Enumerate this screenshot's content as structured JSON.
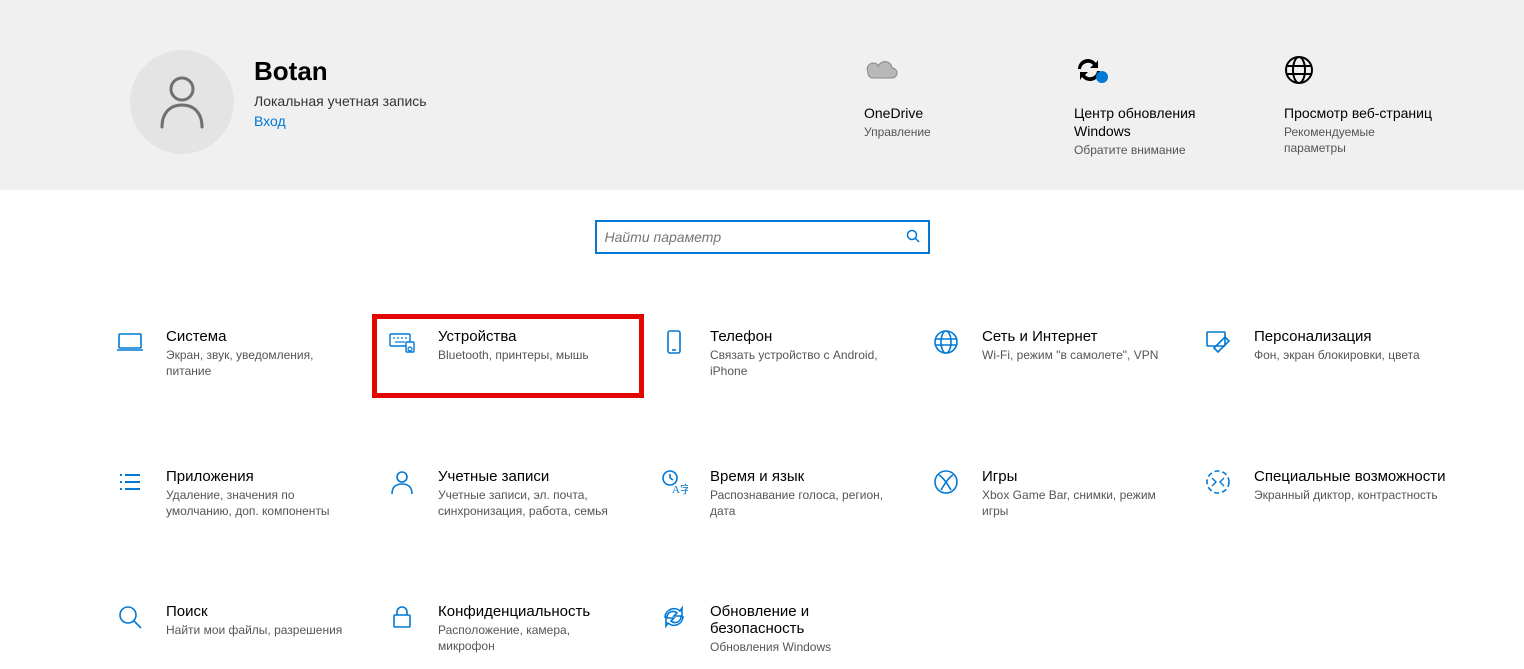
{
  "colors": {
    "accent": "#0078d4",
    "highlight": "#e10600"
  },
  "user": {
    "name": "Botan",
    "account_type": "Локальная учетная запись",
    "signin": "Вход"
  },
  "quick": [
    {
      "title": "OneDrive",
      "sub": "Управление"
    },
    {
      "title": "Центр обновления Windows",
      "sub": "Обратите внимание"
    },
    {
      "title": "Просмотр веб-страниц",
      "sub": "Рекомендуемые параметры"
    }
  ],
  "search": {
    "placeholder": "Найти параметр"
  },
  "categories": [
    {
      "title": "Система",
      "sub": "Экран, звук, уведомления, питание"
    },
    {
      "title": "Устройства",
      "sub": "Bluetooth, принтеры, мышь"
    },
    {
      "title": "Телефон",
      "sub": "Связать устройство с Android, iPhone"
    },
    {
      "title": "Сеть и Интернет",
      "sub": "Wi-Fi, режим \"в самолете\", VPN"
    },
    {
      "title": "Персонализация",
      "sub": "Фон, экран блокировки, цвета"
    },
    {
      "title": "Приложения",
      "sub": "Удаление, значения по умолчанию, доп. компоненты"
    },
    {
      "title": "Учетные записи",
      "sub": "Учетные записи, эл. почта, синхронизация, работа, семья"
    },
    {
      "title": "Время и язык",
      "sub": "Распознавание голоса, регион, дата"
    },
    {
      "title": "Игры",
      "sub": "Xbox Game Bar, снимки, режим игры"
    },
    {
      "title": "Специальные возможности",
      "sub": "Экранный диктор, контрастность"
    },
    {
      "title": "Поиск",
      "sub": "Найти мои файлы, разрешения"
    },
    {
      "title": "Конфиденциальность",
      "sub": "Расположение, камера, микрофон"
    },
    {
      "title": "Обновление и безопасность",
      "sub": "Обновления Windows"
    }
  ]
}
